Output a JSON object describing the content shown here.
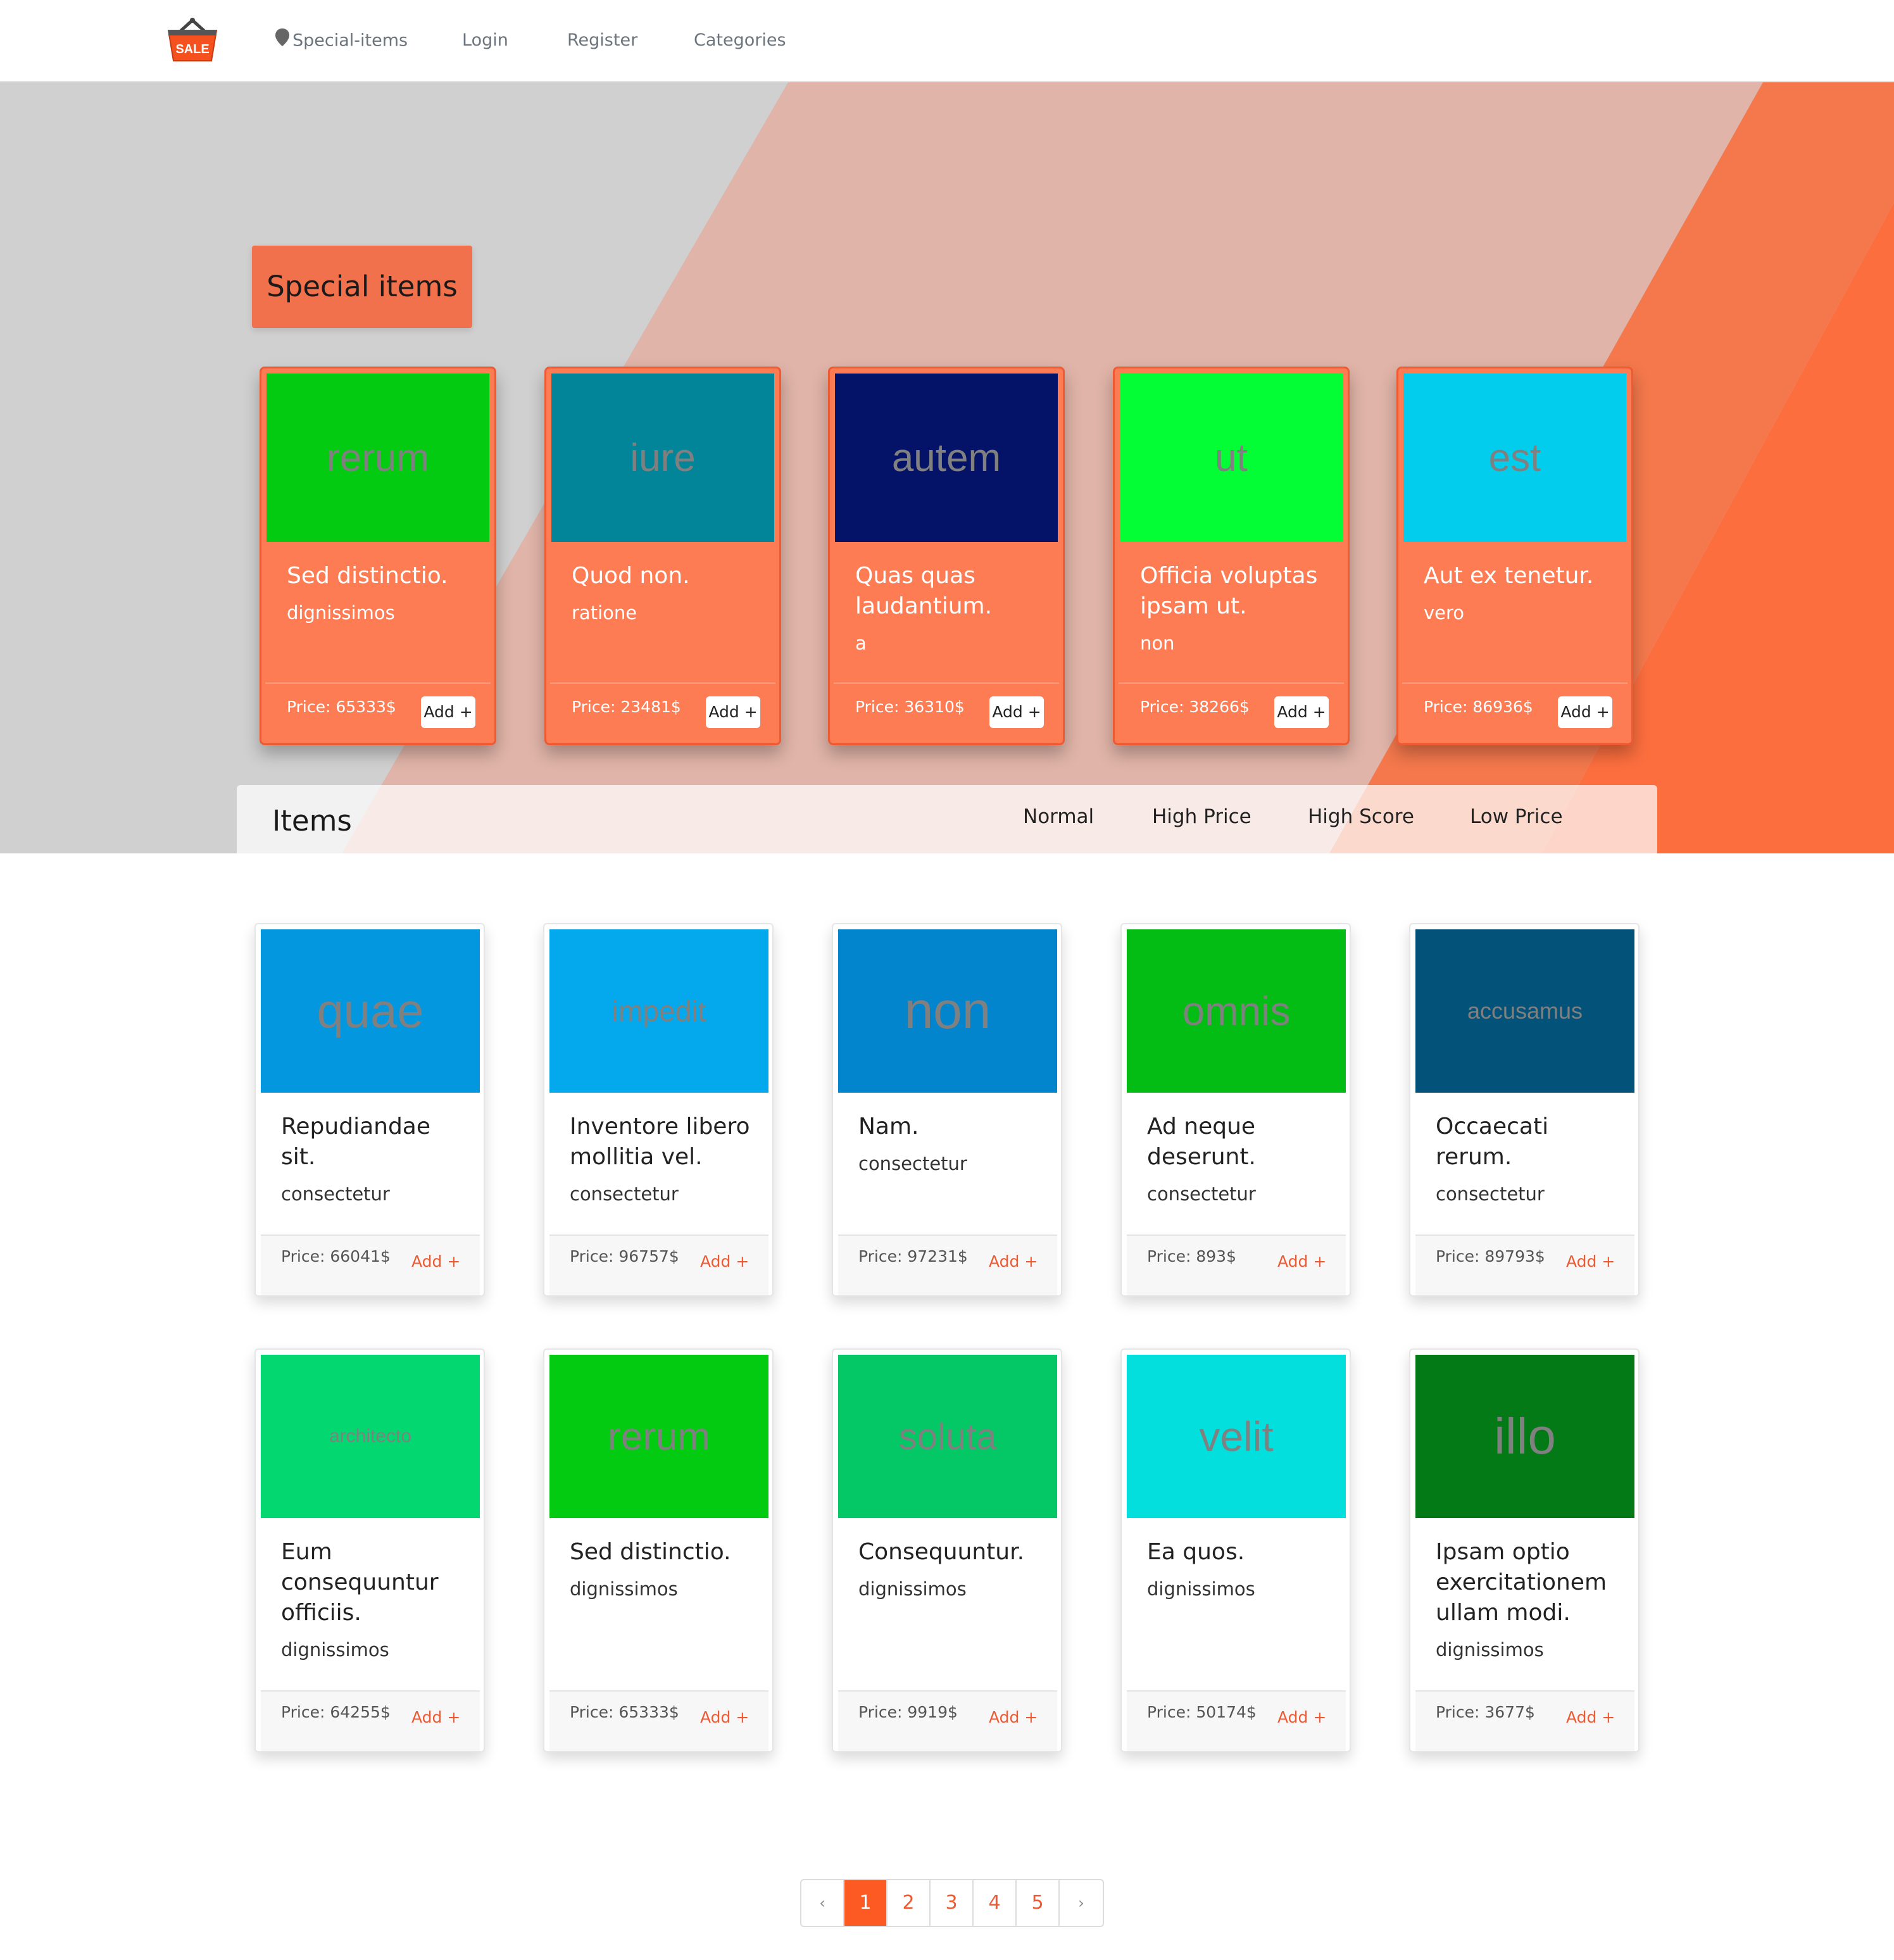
{
  "navbar": {
    "logo_text": "SALE",
    "links": [
      "Special-items",
      "Login",
      "Register",
      "Categories"
    ]
  },
  "special": {
    "title": "Special items",
    "add_label": "Add +",
    "cards": [
      {
        "img_text": "rerum",
        "img_color": "#03cb12",
        "title": "Sed distinctio.",
        "subtitle": "dignissimos",
        "price": "Price: 65333$"
      },
      {
        "img_text": "iure",
        "img_color": "#028598",
        "title": "Quod non.",
        "subtitle": "ratione",
        "price": "Price: 23481$"
      },
      {
        "img_text": "autem",
        "img_color": "#041268",
        "title": "Quas quas laudantium.",
        "subtitle": "a",
        "price": "Price: 36310$"
      },
      {
        "img_text": "ut",
        "img_color": "#03fe35",
        "title": "Officia voluptas ipsam ut.",
        "subtitle": "non",
        "price": "Price: 38266$"
      },
      {
        "img_text": "est",
        "img_color": "#02cded",
        "title": "Aut ex tenetur.",
        "subtitle": "vero",
        "price": "Price: 86936$"
      }
    ]
  },
  "items": {
    "title": "Items",
    "sort_options": [
      "Normal",
      "High Price",
      "High Score",
      "Low Price"
    ],
    "add_label": "Add +",
    "cards": [
      {
        "img_text": "quae",
        "img_color": "#0397df",
        "title": "Repudiandae sit.",
        "subtitle": "consectetur",
        "price": "Price: 66041$"
      },
      {
        "img_text": "impedit",
        "img_color": "#03a9ec",
        "title": "Inventore libero mollitia vel.",
        "subtitle": "consectetur",
        "price": "Price: 96757$"
      },
      {
        "img_text": "non",
        "img_color": "#0385cd",
        "title": "Nam.",
        "subtitle": "consectetur",
        "price": "Price: 97231$"
      },
      {
        "img_text": "omnis",
        "img_color": "#03bd14",
        "title": "Ad neque deserunt.",
        "subtitle": "consectetur",
        "price": "Price: 893$"
      },
      {
        "img_text": "accusamus",
        "img_color": "#03527a",
        "title": "Occaecati rerum.",
        "subtitle": "consectetur",
        "price": "Price: 89793$"
      },
      {
        "img_text": "architecto",
        "img_color": "#03d870",
        "title": "Eum consequuntur officiis.",
        "subtitle": "dignissimos",
        "price": "Price: 64255$"
      },
      {
        "img_text": "rerum",
        "img_color": "#03cb12",
        "title": "Sed distinctio.",
        "subtitle": "dignissimos",
        "price": "Price: 65333$"
      },
      {
        "img_text": "soluta",
        "img_color": "#03c865",
        "title": "Consequuntur.",
        "subtitle": "dignissimos",
        "price": "Price: 9919$"
      },
      {
        "img_text": "velit",
        "img_color": "#03dfdc",
        "title": "Ea quos.",
        "subtitle": "dignissimos",
        "price": "Price: 50174$"
      },
      {
        "img_text": "illo",
        "img_color": "#037a15",
        "title": "Ipsam optio exercitationem ullam modi.",
        "subtitle": "dignissimos",
        "price": "Price: 3677$"
      }
    ]
  },
  "pagination": {
    "prev": "‹",
    "pages": [
      "1",
      "2",
      "3",
      "4",
      "5"
    ],
    "next": "›",
    "active_page": "1"
  },
  "colors": {
    "accent": "#fc5a22",
    "card_orange": "#fe7c54",
    "hero_gray": "#d0d0d0",
    "hero_pink": "#e0b4a8"
  }
}
